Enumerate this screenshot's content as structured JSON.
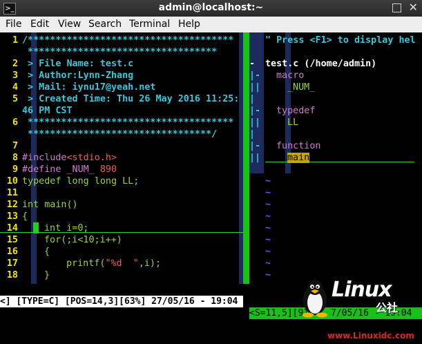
{
  "window": {
    "title": "admin@localhost:~"
  },
  "menu": [
    "File",
    "Edit",
    "View",
    "Search",
    "Terminal",
    "Help"
  ],
  "editor": {
    "lines": [
      {
        "num": "1",
        "text": "/*************************************"
      },
      {
        "num": "",
        "text": " **********************************"
      },
      {
        "num": "2",
        "text": " > File Name: test.c"
      },
      {
        "num": "3",
        "text": " > Author:Lynn-Zhang"
      },
      {
        "num": "4",
        "text": " > Mail: iynu17@yeah.net"
      },
      {
        "num": "5",
        "text": " > Created Time: Thu 26 May 2016 11:25:"
      },
      {
        "num": "",
        "text": "46 PM CST"
      },
      {
        "num": "6",
        "text": " *************************************"
      },
      {
        "num": "",
        "text": " *********************************/"
      },
      {
        "num": "7",
        "text": ""
      },
      {
        "num": "8",
        "text_a": "#include",
        "text_b": "<stdio.h>"
      },
      {
        "num": "9",
        "text_a": "#define _NUM_ ",
        "text_b": "890"
      },
      {
        "num": "10",
        "text_a": "typedef long long ",
        "text_b": "LL;"
      },
      {
        "num": "11",
        "text": ""
      },
      {
        "num": "12",
        "text_a": "int ",
        "text_b": "main()"
      },
      {
        "num": "13",
        "text": "{"
      },
      {
        "num": "14",
        "text_a": "int ",
        "text_b": "i=0;"
      },
      {
        "num": "15",
        "text_a": "for",
        "text_b": "(;i<10;i++)"
      },
      {
        "num": "16",
        "text": "{"
      },
      {
        "num": "17",
        "text_a": "printf(",
        "text_b": "\"%d  \"",
        "text_c": ",i);"
      },
      {
        "num": "18",
        "text": "}"
      }
    ]
  },
  "taglist": {
    "help": "\" Press <F1> to display hel",
    "file": "test.c (/home/admin)",
    "sections": [
      {
        "name": "macro",
        "item": "_NUM_"
      },
      {
        "name": "typedef",
        "item": "LL"
      },
      {
        "name": "function",
        "item": "main"
      }
    ],
    "tilde": "~"
  },
  "status": {
    "left": "<] [TYPE=C] [POS=14,3][63%] 27/05/16 - 19:04",
    "right": "<S=11,5][91",
    "right_tail": "7/05/16 - 19:04"
  },
  "watermark": {
    "title": "Linux",
    "sub": "公社",
    "url": "www.Linuxidc.com"
  }
}
